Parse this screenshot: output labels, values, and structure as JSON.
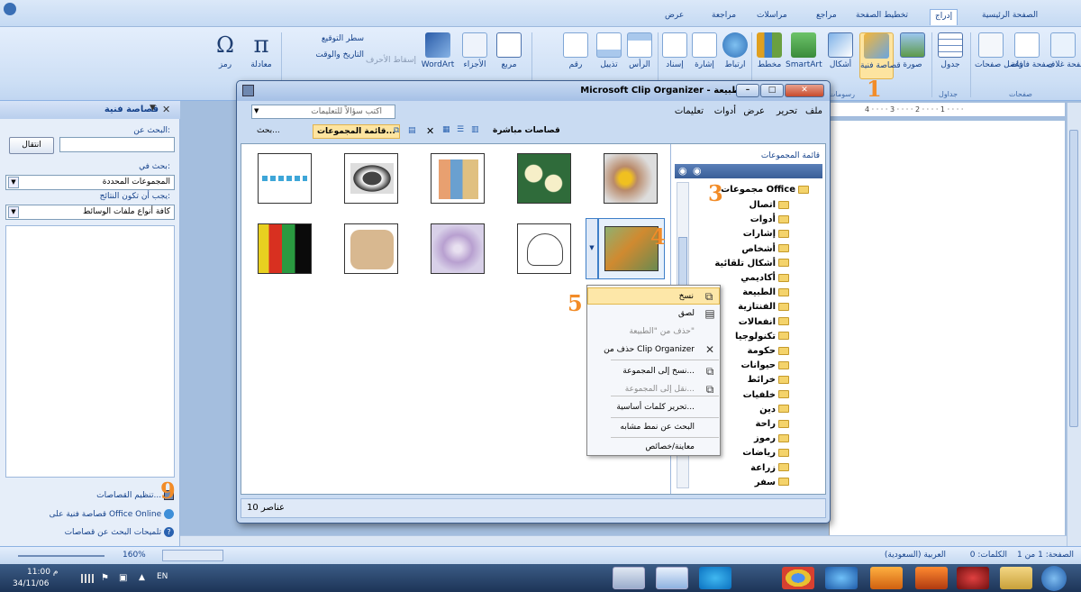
{
  "ribbon": {
    "tabs": [
      "الصفحة الرئيسية",
      "إدراج",
      "تخطيط الصفحة",
      "مراجع",
      "مراسلات",
      "مراجعة",
      "عرض"
    ],
    "active_tab": "إدراج",
    "buttons": {
      "cover_page": "صفحة غلاف",
      "blank_page": "صفحة فارغة",
      "page_break": "فاصل صفحات",
      "table": "جدول",
      "picture": "صورة",
      "clip_art": "قصاصة فنية",
      "shapes": "أشكال",
      "smartart": "SmartArt",
      "chart": "مخطط",
      "hyperlink": "ارتباط",
      "bookmark": "إشارة",
      "cross_ref": "إسناد",
      "header": "الرأس",
      "footer": "تذييل",
      "page_number": "رقم",
      "text_box": "مربع",
      "quick_parts": "الأجزاء",
      "wordart": "WordArt",
      "drop_cap": "إسقاط الأحرف",
      "signature_line": "سطر التوقيع",
      "date_time": "التاريخ والوقت",
      "equation": "معادلة",
      "symbol": "رمز"
    },
    "groups": {
      "pages": "صفحات",
      "tables": "جداول",
      "illustrations": "رسومات"
    }
  },
  "clip_pane": {
    "title": "قصاصة فنية",
    "search_label": "البحث عن:",
    "search_value": "",
    "go_button": "انتقال",
    "search_in_label": "بحث في:",
    "search_in_value": "المجموعات المحددة",
    "results_label": "يجب أن تكون النتائج:",
    "results_value": "كافة أنواع ملفات الوسائط",
    "links": [
      "تنظيم القصاصات...",
      "قصاصة فنية على Office Online",
      "تلميحات البحث عن قصاصات"
    ]
  },
  "organizer": {
    "title": "Microsoft Clip Organizer - الطبيعة",
    "menu": [
      "ملف",
      "تحرير",
      "عرض",
      "أدوات",
      "تعليمات"
    ],
    "question_placeholder": "اكتب سؤالاً للتعليمات",
    "toolbar": {
      "search": "بحث...",
      "collection_list": "قائمة المجموعات...",
      "clips_online": "قصاصات مباشرة"
    },
    "collection_list_title": "قائمة المجموعات",
    "collections_root": "مجموعات Office",
    "collections": [
      "اتصال",
      "أدوات",
      "إشارات",
      "أشخاص",
      "أشكال تلقائية",
      "أكاديمي",
      "الطبيعة",
      "الفنتازية",
      "انفعالات",
      "تكنولوجيا",
      "حكومة",
      "حيوانات",
      "خرائط",
      "خلفيات",
      "دين",
      "راحة",
      "رموز",
      "رياضات",
      "زراعة",
      "سفر"
    ],
    "items_count": "10 عناصر",
    "thumbnails": [
      "beads",
      "cow",
      "people",
      "roses",
      "flower",
      "abstract",
      "leaves",
      "snowflake",
      "rabbit",
      "tiger"
    ]
  },
  "context_menu": [
    {
      "label": "نسخ",
      "state": "highlight"
    },
    {
      "label": "لصق",
      "state": "normal"
    },
    {
      "label": "حذف من \"الطبيعة\"",
      "state": "disabled"
    },
    {
      "label": "حذف من Clip Organizer",
      "state": "normal"
    },
    {
      "label": "نسخ إلى المجموعة...",
      "state": "normal"
    },
    {
      "label": "نقل إلى المجموعة...",
      "state": "disabled"
    },
    {
      "label": "تحرير كلمات أساسية...",
      "state": "normal"
    },
    {
      "label": "البحث عن نمط مشابه",
      "state": "normal"
    },
    {
      "label": "معاينة/خصائص",
      "state": "normal"
    }
  ],
  "status": {
    "page": "الصفحة: 1 من 1",
    "words": "الكلمات: 0",
    "language": "العربية (السعودية)",
    "zoom": "160%"
  },
  "taskbar": {
    "time": "11:00 م",
    "date": "34/11/06",
    "lang": "EN"
  },
  "annotations": [
    "1",
    "3",
    "4",
    "5",
    "9"
  ]
}
